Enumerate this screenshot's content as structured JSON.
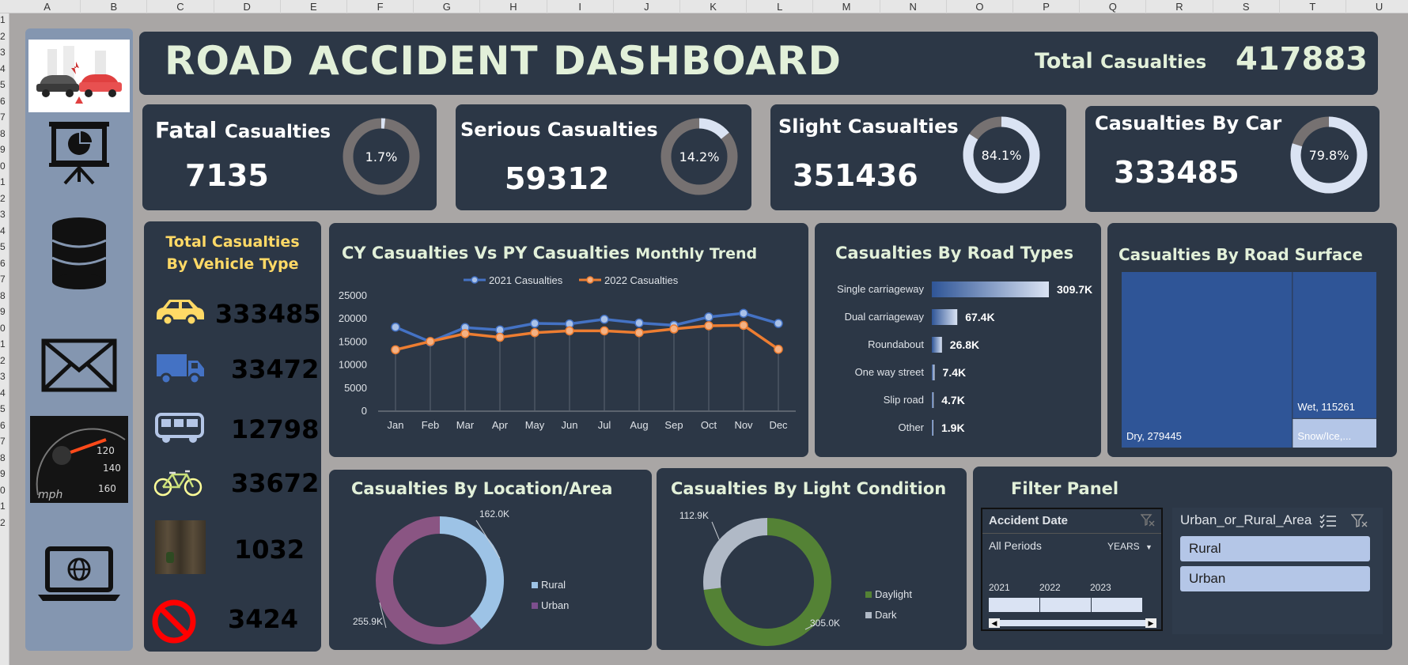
{
  "spreadsheet": {
    "columns": [
      "A",
      "B",
      "C",
      "D",
      "E",
      "F",
      "G",
      "H",
      "I",
      "J",
      "K",
      "L",
      "M",
      "N",
      "O",
      "P",
      "Q",
      "R",
      "S",
      "T",
      "U"
    ],
    "rows": [
      "1",
      "2",
      "3",
      "4",
      "5",
      "6",
      "7",
      "8",
      "9",
      "0",
      "1",
      "2",
      "3",
      "4",
      "5",
      "6",
      "7",
      "8",
      "9",
      "0",
      "1",
      "2",
      "3",
      "4",
      "5",
      "6",
      "7",
      "8",
      "9",
      "0",
      "1",
      "2"
    ]
  },
  "sidebar": {
    "icons": [
      "car-crash-image",
      "presentation-chart-icon",
      "database-icon",
      "mail-icon",
      "speedometer-image",
      "laptop-globe-icon"
    ]
  },
  "header": {
    "title": "ROAD ACCIDENT DASHBOARD",
    "total_label_big": "Total",
    "total_label_small": "Casualties",
    "total_value": "417883"
  },
  "kpis": [
    {
      "label_big": "Fatal",
      "label_small": "Casualties",
      "value": "7135",
      "pct_label": "1.7%",
      "pct": 0.017
    },
    {
      "label_big": "Serious Casualties",
      "label_small": "",
      "value": "59312",
      "pct_label": "14.2%",
      "pct": 0.142
    },
    {
      "label_big": "Slight Casualties",
      "label_small": "",
      "value": "351436",
      "pct_label": "84.1%",
      "pct": 0.841
    },
    {
      "label_big": "Casualties By Car",
      "label_small": "",
      "value": "333485",
      "pct_label": "79.8%",
      "pct": 0.798
    }
  ],
  "vehicle_panel": {
    "title_line1": "Total Casualties",
    "title_line2": "By Vehicle Type",
    "items": [
      {
        "icon": "car-icon",
        "value": "333485",
        "color": "#ffd966"
      },
      {
        "icon": "truck-icon",
        "value": "33472",
        "color": "#4472c4"
      },
      {
        "icon": "bus-icon",
        "value": "12798",
        "color": "#b4c6e7"
      },
      {
        "icon": "bicycle-icon",
        "value": "33672",
        "color": "#ffff00"
      },
      {
        "icon": "agricultural-image",
        "value": "1032",
        "color": "#00b050"
      },
      {
        "icon": "no-entry-icon",
        "value": "3424",
        "color": "#ff0000"
      }
    ]
  },
  "trend": {
    "title_big": "CY Casualties Vs PY Casualties",
    "title_small": "Monthly Trend"
  },
  "road_types": {
    "title": "Casualties By Road Types"
  },
  "road_surface": {
    "title": "Casualties By Road Surface"
  },
  "location": {
    "title": "Casualties By Location/Area"
  },
  "light": {
    "title": "Casualties By Light Condition"
  },
  "filter": {
    "title": "Filter Panel",
    "date_slicer": {
      "header": "Accident Date",
      "period": "All Periods",
      "unit": "YEARS",
      "years": [
        "2021",
        "2022",
        "2023"
      ]
    },
    "area_slicer": {
      "header": "Urban_or_Rural_Area",
      "options": [
        "Rural",
        "Urban"
      ]
    }
  },
  "colors": {
    "card": "#2c3746",
    "title": "#e2f0d9",
    "series_2021": "#4472c4",
    "series_2022": "#ed7d31",
    "donut_track": "#767171",
    "donut_fill": "#dae3f3"
  },
  "chart_data": [
    {
      "type": "line",
      "title": "CY Casualties Vs PY Casualties Monthly Trend",
      "categories": [
        "Jan",
        "Feb",
        "Mar",
        "Apr",
        "May",
        "Jun",
        "Jul",
        "Aug",
        "Sep",
        "Oct",
        "Nov",
        "Dec"
      ],
      "series": [
        {
          "name": "2021 Casualties",
          "values": [
            18200,
            15000,
            18100,
            17600,
            19000,
            18900,
            19900,
            19100,
            18600,
            20400,
            21200,
            19000
          ]
        },
        {
          "name": "2022 Casualties",
          "values": [
            13300,
            15100,
            16800,
            16000,
            17000,
            17400,
            17400,
            17000,
            17800,
            18500,
            18600,
            13400
          ]
        }
      ],
      "yticks": [
        "0",
        "5000",
        "10000",
        "15000",
        "20000",
        "25000"
      ],
      "ylim": [
        0,
        25000
      ],
      "legend": "top"
    },
    {
      "type": "bar",
      "title": "Casualties By Road Types",
      "categories": [
        "Single carriageway",
        "Dual carriageway",
        "Roundabout",
        "One way street",
        "Slip road",
        "Other"
      ],
      "values": [
        309.7,
        67.4,
        26.8,
        7.4,
        4.7,
        1.9
      ],
      "labels": [
        "309.7K",
        "67.4K",
        "26.8K",
        "7.4K",
        "4.7K",
        "1.9K"
      ],
      "orientation": "horizontal"
    },
    {
      "type": "heatmap",
      "title": "Casualties By Road Surface",
      "items": [
        {
          "name": "Dry",
          "label": "Dry, 279445",
          "value": 279445
        },
        {
          "name": "Wet",
          "label": "Wet, 115261",
          "value": 115261
        },
        {
          "name": "Snow/Ice",
          "label": "Snow/Ice,...",
          "value": 23177
        }
      ]
    },
    {
      "type": "pie",
      "title": "Casualties By Location/Area",
      "categories": [
        "Rural",
        "Urban"
      ],
      "values": [
        162.0,
        255.9
      ],
      "labels": [
        "162.0K",
        "255.9K"
      ],
      "legend": "right"
    },
    {
      "type": "pie",
      "title": "Casualties By Light Condition",
      "categories": [
        "Daylight",
        "Dark"
      ],
      "values": [
        305.0,
        112.9
      ],
      "labels": [
        "305.0K",
        "112.9K"
      ],
      "legend": "right"
    }
  ]
}
